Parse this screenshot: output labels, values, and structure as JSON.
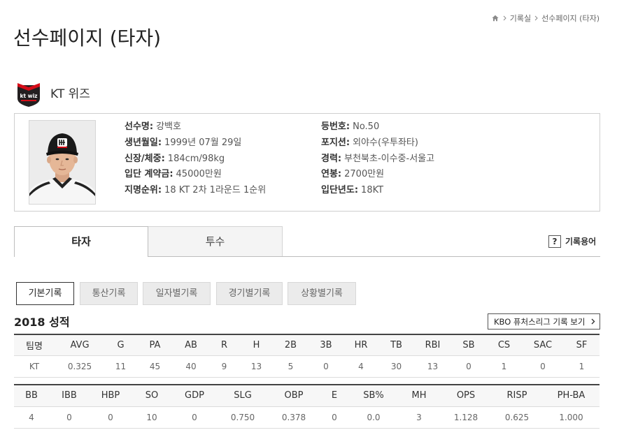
{
  "breadcrumb": {
    "home_icon": "home-icon",
    "separator_icon": "chevron-right-icon",
    "items": [
      "기록실",
      "선수페이지 (타자)"
    ]
  },
  "page_title": "선수페이지 (타자)",
  "team": {
    "logo": "kt-wiz-logo",
    "logo_text": "kt wiz",
    "name": "KT 위즈",
    "colors": {
      "red": "#d60c18",
      "black": "#231f20"
    }
  },
  "player": {
    "photo": "player-photo",
    "left": [
      {
        "label": "선수명:",
        "value": "강백호"
      },
      {
        "label": "생년월일:",
        "value": "1999년 07월 29일"
      },
      {
        "label": "신장/체중:",
        "value": "184cm/98kg"
      },
      {
        "label": "입단 계약금:",
        "value": "45000만원"
      },
      {
        "label": "지명순위:",
        "value": "18 KT 2차 1라운드 1순위"
      }
    ],
    "right": [
      {
        "label": "등번호:",
        "value": "No.50"
      },
      {
        "label": "포지션:",
        "value": "외야수(우투좌타)"
      },
      {
        "label": "경력:",
        "value": "부천북초-이수중-서울고"
      },
      {
        "label": "연봉:",
        "value": "2700만원"
      },
      {
        "label": "입단년도:",
        "value": "18KT"
      }
    ]
  },
  "main_tabs": [
    {
      "label": "타자",
      "active": true
    },
    {
      "label": "투수",
      "active": false
    }
  ],
  "glossary": {
    "icon": "question-icon",
    "icon_glyph": "?",
    "label": "기록용어"
  },
  "sub_tabs": [
    {
      "label": "기본기록",
      "active": true
    },
    {
      "label": "통산기록",
      "active": false
    },
    {
      "label": "일자별기록",
      "active": false
    },
    {
      "label": "경기별기록",
      "active": false
    },
    {
      "label": "상황별기록",
      "active": false
    }
  ],
  "season_title": "2018 성적",
  "futures_link": {
    "label": "KBO 퓨처스리그 기록 보기",
    "icon": "chevron-right-icon"
  },
  "stats_basic": {
    "headers": [
      "팀명",
      "AVG",
      "G",
      "PA",
      "AB",
      "R",
      "H",
      "2B",
      "3B",
      "HR",
      "TB",
      "RBI",
      "SB",
      "CS",
      "SAC",
      "SF"
    ],
    "rows": [
      [
        "KT",
        "0.325",
        "11",
        "45",
        "40",
        "9",
        "13",
        "5",
        "0",
        "4",
        "30",
        "13",
        "0",
        "1",
        "0",
        "1"
      ]
    ]
  },
  "stats_extra": {
    "headers": [
      "BB",
      "IBB",
      "HBP",
      "SO",
      "GDP",
      "SLG",
      "OBP",
      "E",
      "SB%",
      "MH",
      "OPS",
      "RISP",
      "PH-BA"
    ],
    "rows": [
      [
        "4",
        "0",
        "0",
        "10",
        "0",
        "0.750",
        "0.378",
        "0",
        "0.0",
        "3",
        "1.128",
        "0.625",
        "1.000"
      ]
    ]
  },
  "theme": {
    "text": "#333333",
    "muted": "#666666",
    "table_rule": "#444444",
    "active_border": "#333333"
  }
}
